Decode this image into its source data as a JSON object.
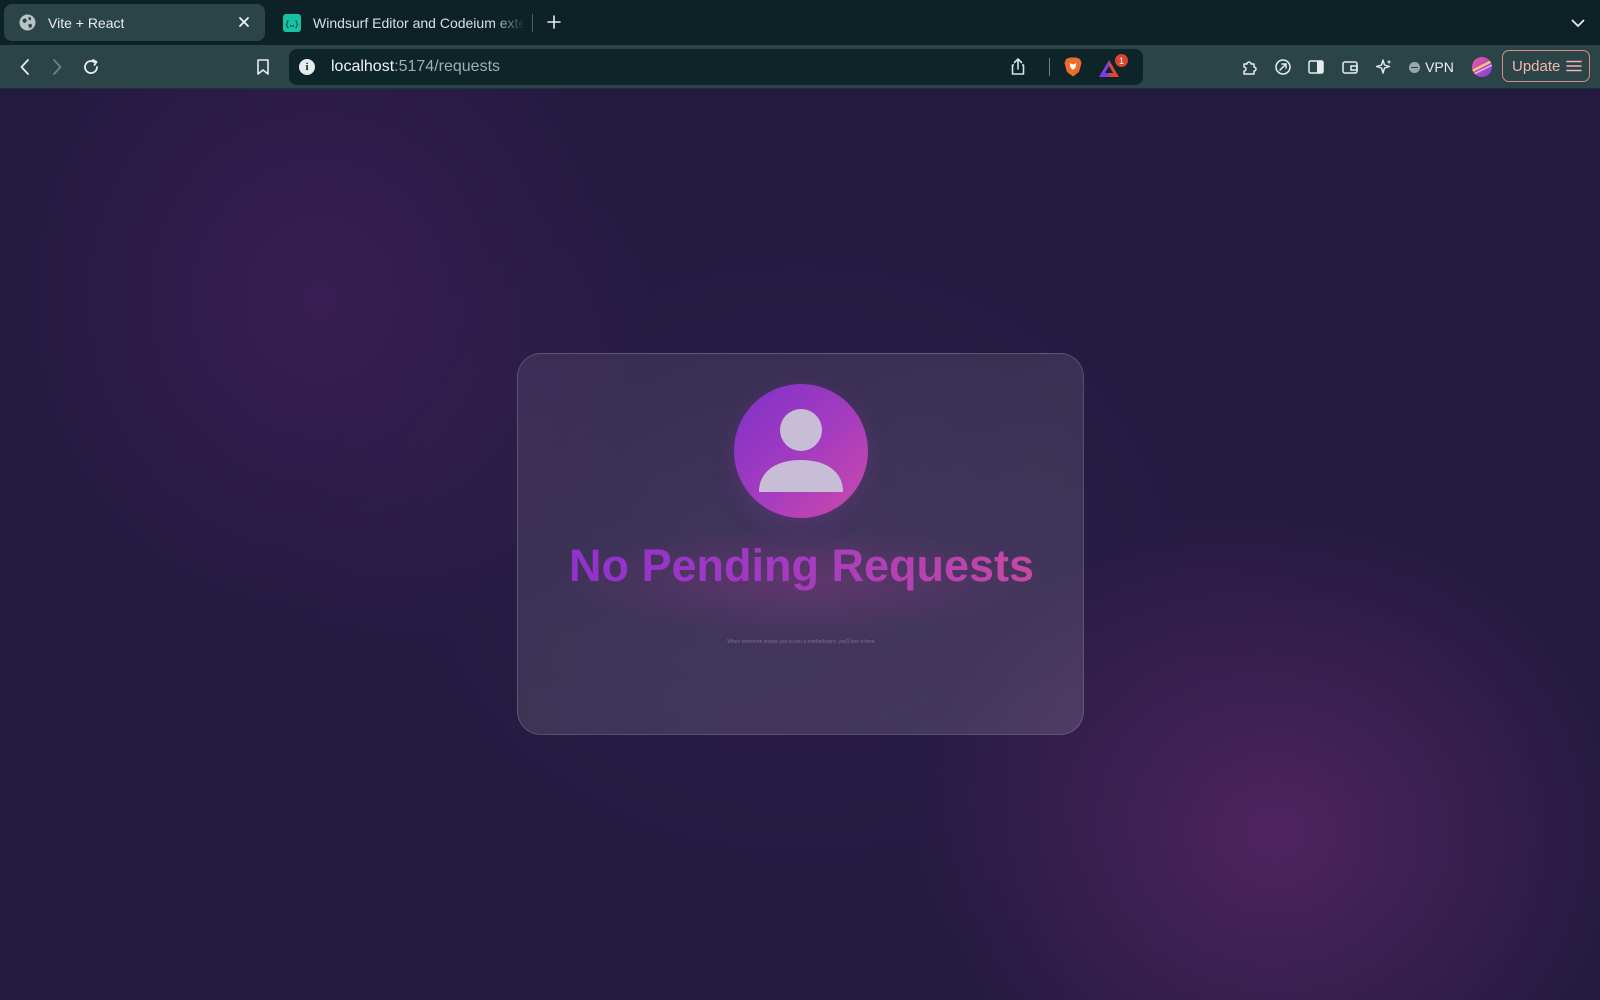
{
  "browser": {
    "tabs": [
      {
        "title": "Vite + React",
        "active": true,
        "icon": "globe-icon"
      },
      {
        "title": "Windsurf Editor and Codeium extensions",
        "active": false,
        "icon": "codeium-icon"
      }
    ],
    "address_bar": {
      "host": "localhost",
      "path": ":5174/requests"
    },
    "rewards_badge": "1",
    "vpn_label": "VPN",
    "update_label": "Update"
  },
  "page": {
    "title": "No Pending Requests",
    "subtitle": "When someone invites you to join a marketboard, you'll see it here."
  },
  "colors": {
    "tab_strip": "#0c2227",
    "toolbar": "#2b4448",
    "page_bg": "#231a3f",
    "accent_start": "#8a2fd0",
    "accent_end": "#cf4a9e"
  }
}
